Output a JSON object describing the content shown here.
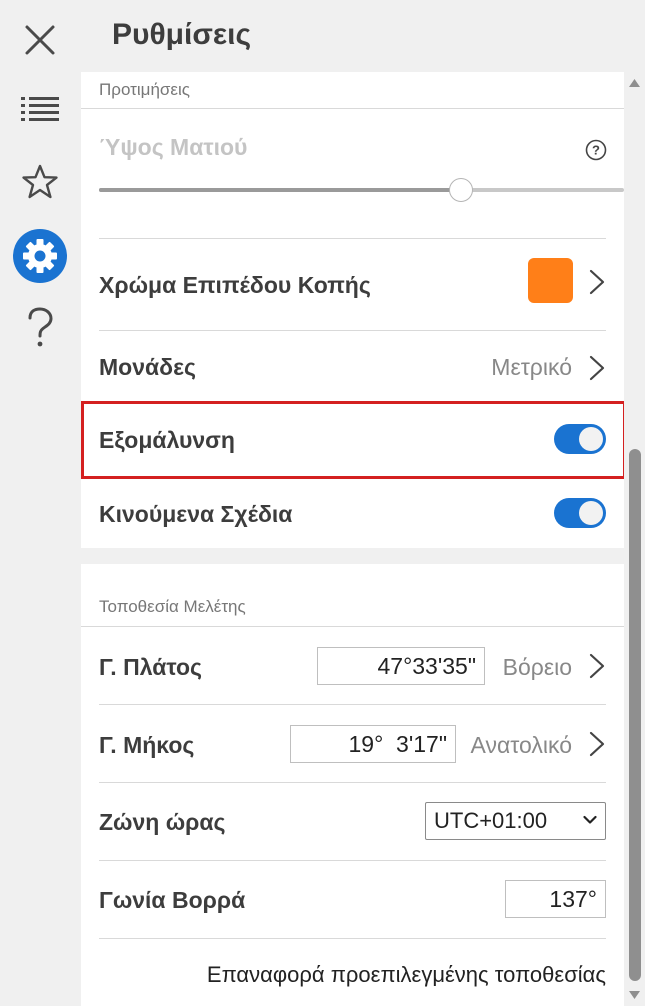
{
  "header": {
    "title": "Ρυθμίσεις"
  },
  "rail": {
    "items": [
      {
        "icon": "close-icon"
      },
      {
        "icon": "list-icon"
      },
      {
        "icon": "star-icon"
      },
      {
        "icon": "gear-icon",
        "active": true
      },
      {
        "icon": "help-icon"
      }
    ],
    "accent": "#1a73d1"
  },
  "preferences": {
    "section_label": "Προτιμήσεις",
    "eye_height": {
      "label": "Ύψος Ματιού",
      "help_glyph": "?",
      "slider_fraction": 0.69
    },
    "cut_plane_color": {
      "label": "Χρώμα Επιπέδου Κοπής",
      "color": "#ff7f18"
    },
    "units": {
      "label": "Μονάδες",
      "value": "Μετρικό"
    },
    "antialiasing": {
      "label": "Εξομάλυνση",
      "enabled": true
    },
    "animated_plans": {
      "label": "Κινούμενα Σχέδια",
      "enabled": true
    }
  },
  "location": {
    "section_label": "Τοποθεσία Μελέτης",
    "latitude": {
      "label": "Γ. Πλάτος",
      "value": "47°33'35\"",
      "hemisphere": "Βόρειο"
    },
    "longitude": {
      "label": "Γ. Μήκος",
      "value": "19°  3'17\"",
      "hemisphere": "Ανατολικό"
    },
    "timezone": {
      "label": "Ζώνη ώρας",
      "value": "UTC+01:00"
    },
    "north_angle": {
      "label": "Γωνία Βορρά",
      "value": "137°"
    },
    "reset_link": "Επαναφορά προεπιλεγμένης τοποθεσίας"
  },
  "colors": {
    "toggle_on": "#1a73d1",
    "highlight": "#d42020"
  }
}
